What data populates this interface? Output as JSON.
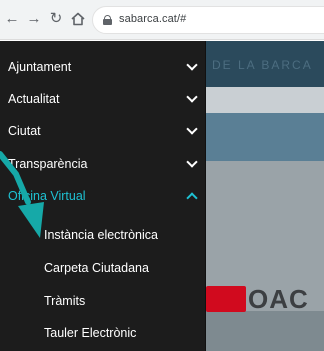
{
  "browser": {
    "url": "sabarca.cat/#"
  },
  "background": {
    "header_text": "DE LA BARCA",
    "logo_text": "OAC"
  },
  "menu": {
    "items": [
      {
        "label": "Ajuntament"
      },
      {
        "label": "Actualitat"
      },
      {
        "label": "Ciutat"
      },
      {
        "label": "Transparència"
      },
      {
        "label": "Oficina Virtual"
      }
    ],
    "subitems": [
      {
        "label": "Instància electrònica"
      },
      {
        "label": "Carpeta Ciutadana"
      },
      {
        "label": "Tràmits"
      },
      {
        "label": "Tauler Electrònic"
      }
    ]
  },
  "colors": {
    "accent": "#1ec1d2",
    "menu_bg": "#1c1c1c",
    "arrow": "#16a9a8"
  }
}
